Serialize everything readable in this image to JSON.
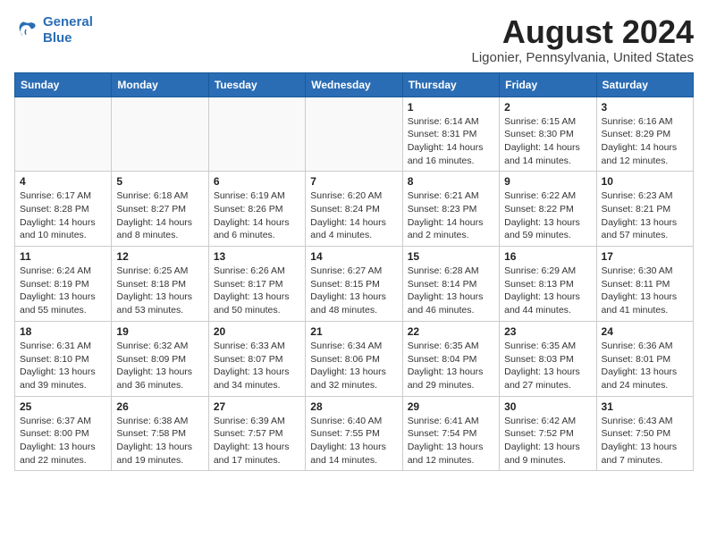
{
  "header": {
    "logo_line1": "General",
    "logo_line2": "Blue",
    "month_year": "August 2024",
    "location": "Ligonier, Pennsylvania, United States"
  },
  "days_of_week": [
    "Sunday",
    "Monday",
    "Tuesday",
    "Wednesday",
    "Thursday",
    "Friday",
    "Saturday"
  ],
  "weeks": [
    [
      {
        "day": "",
        "sunrise": "",
        "sunset": "",
        "daylight": ""
      },
      {
        "day": "",
        "sunrise": "",
        "sunset": "",
        "daylight": ""
      },
      {
        "day": "",
        "sunrise": "",
        "sunset": "",
        "daylight": ""
      },
      {
        "day": "",
        "sunrise": "",
        "sunset": "",
        "daylight": ""
      },
      {
        "day": "1",
        "sunrise": "Sunrise: 6:14 AM",
        "sunset": "Sunset: 8:31 PM",
        "daylight": "Daylight: 14 hours and 16 minutes."
      },
      {
        "day": "2",
        "sunrise": "Sunrise: 6:15 AM",
        "sunset": "Sunset: 8:30 PM",
        "daylight": "Daylight: 14 hours and 14 minutes."
      },
      {
        "day": "3",
        "sunrise": "Sunrise: 6:16 AM",
        "sunset": "Sunset: 8:29 PM",
        "daylight": "Daylight: 14 hours and 12 minutes."
      }
    ],
    [
      {
        "day": "4",
        "sunrise": "Sunrise: 6:17 AM",
        "sunset": "Sunset: 8:28 PM",
        "daylight": "Daylight: 14 hours and 10 minutes."
      },
      {
        "day": "5",
        "sunrise": "Sunrise: 6:18 AM",
        "sunset": "Sunset: 8:27 PM",
        "daylight": "Daylight: 14 hours and 8 minutes."
      },
      {
        "day": "6",
        "sunrise": "Sunrise: 6:19 AM",
        "sunset": "Sunset: 8:26 PM",
        "daylight": "Daylight: 14 hours and 6 minutes."
      },
      {
        "day": "7",
        "sunrise": "Sunrise: 6:20 AM",
        "sunset": "Sunset: 8:24 PM",
        "daylight": "Daylight: 14 hours and 4 minutes."
      },
      {
        "day": "8",
        "sunrise": "Sunrise: 6:21 AM",
        "sunset": "Sunset: 8:23 PM",
        "daylight": "Daylight: 14 hours and 2 minutes."
      },
      {
        "day": "9",
        "sunrise": "Sunrise: 6:22 AM",
        "sunset": "Sunset: 8:22 PM",
        "daylight": "Daylight: 13 hours and 59 minutes."
      },
      {
        "day": "10",
        "sunrise": "Sunrise: 6:23 AM",
        "sunset": "Sunset: 8:21 PM",
        "daylight": "Daylight: 13 hours and 57 minutes."
      }
    ],
    [
      {
        "day": "11",
        "sunrise": "Sunrise: 6:24 AM",
        "sunset": "Sunset: 8:19 PM",
        "daylight": "Daylight: 13 hours and 55 minutes."
      },
      {
        "day": "12",
        "sunrise": "Sunrise: 6:25 AM",
        "sunset": "Sunset: 8:18 PM",
        "daylight": "Daylight: 13 hours and 53 minutes."
      },
      {
        "day": "13",
        "sunrise": "Sunrise: 6:26 AM",
        "sunset": "Sunset: 8:17 PM",
        "daylight": "Daylight: 13 hours and 50 minutes."
      },
      {
        "day": "14",
        "sunrise": "Sunrise: 6:27 AM",
        "sunset": "Sunset: 8:15 PM",
        "daylight": "Daylight: 13 hours and 48 minutes."
      },
      {
        "day": "15",
        "sunrise": "Sunrise: 6:28 AM",
        "sunset": "Sunset: 8:14 PM",
        "daylight": "Daylight: 13 hours and 46 minutes."
      },
      {
        "day": "16",
        "sunrise": "Sunrise: 6:29 AM",
        "sunset": "Sunset: 8:13 PM",
        "daylight": "Daylight: 13 hours and 44 minutes."
      },
      {
        "day": "17",
        "sunrise": "Sunrise: 6:30 AM",
        "sunset": "Sunset: 8:11 PM",
        "daylight": "Daylight: 13 hours and 41 minutes."
      }
    ],
    [
      {
        "day": "18",
        "sunrise": "Sunrise: 6:31 AM",
        "sunset": "Sunset: 8:10 PM",
        "daylight": "Daylight: 13 hours and 39 minutes."
      },
      {
        "day": "19",
        "sunrise": "Sunrise: 6:32 AM",
        "sunset": "Sunset: 8:09 PM",
        "daylight": "Daylight: 13 hours and 36 minutes."
      },
      {
        "day": "20",
        "sunrise": "Sunrise: 6:33 AM",
        "sunset": "Sunset: 8:07 PM",
        "daylight": "Daylight: 13 hours and 34 minutes."
      },
      {
        "day": "21",
        "sunrise": "Sunrise: 6:34 AM",
        "sunset": "Sunset: 8:06 PM",
        "daylight": "Daylight: 13 hours and 32 minutes."
      },
      {
        "day": "22",
        "sunrise": "Sunrise: 6:35 AM",
        "sunset": "Sunset: 8:04 PM",
        "daylight": "Daylight: 13 hours and 29 minutes."
      },
      {
        "day": "23",
        "sunrise": "Sunrise: 6:35 AM",
        "sunset": "Sunset: 8:03 PM",
        "daylight": "Daylight: 13 hours and 27 minutes."
      },
      {
        "day": "24",
        "sunrise": "Sunrise: 6:36 AM",
        "sunset": "Sunset: 8:01 PM",
        "daylight": "Daylight: 13 hours and 24 minutes."
      }
    ],
    [
      {
        "day": "25",
        "sunrise": "Sunrise: 6:37 AM",
        "sunset": "Sunset: 8:00 PM",
        "daylight": "Daylight: 13 hours and 22 minutes."
      },
      {
        "day": "26",
        "sunrise": "Sunrise: 6:38 AM",
        "sunset": "Sunset: 7:58 PM",
        "daylight": "Daylight: 13 hours and 19 minutes."
      },
      {
        "day": "27",
        "sunrise": "Sunrise: 6:39 AM",
        "sunset": "Sunset: 7:57 PM",
        "daylight": "Daylight: 13 hours and 17 minutes."
      },
      {
        "day": "28",
        "sunrise": "Sunrise: 6:40 AM",
        "sunset": "Sunset: 7:55 PM",
        "daylight": "Daylight: 13 hours and 14 minutes."
      },
      {
        "day": "29",
        "sunrise": "Sunrise: 6:41 AM",
        "sunset": "Sunset: 7:54 PM",
        "daylight": "Daylight: 13 hours and 12 minutes."
      },
      {
        "day": "30",
        "sunrise": "Sunrise: 6:42 AM",
        "sunset": "Sunset: 7:52 PM",
        "daylight": "Daylight: 13 hours and 9 minutes."
      },
      {
        "day": "31",
        "sunrise": "Sunrise: 6:43 AM",
        "sunset": "Sunset: 7:50 PM",
        "daylight": "Daylight: 13 hours and 7 minutes."
      }
    ]
  ]
}
